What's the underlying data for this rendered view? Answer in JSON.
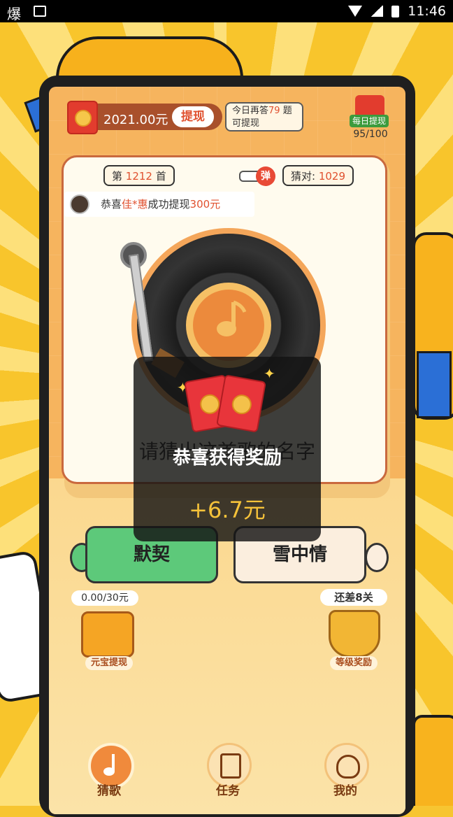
{
  "status_bar": {
    "left_glyph": "爆",
    "time": "11:46"
  },
  "header": {
    "balance": "2021.00元",
    "withdraw_label": "提现",
    "tip_line1_prefix": "今日再答",
    "tip_count": "79",
    "tip_line1_suffix": "题",
    "tip_line2": "可提现",
    "daily_label": "每日提现",
    "daily_progress": "95/100"
  },
  "card": {
    "song_prefix": "第",
    "song_number": "1212",
    "song_suffix": "首",
    "toggle_label": "弹",
    "correct_prefix": "猜对:",
    "correct_count": "1029",
    "notice_prefix": "恭喜",
    "notice_name": "佳*惠",
    "notice_mid": "成功提现",
    "notice_amount": "300元",
    "question": "请猜出这首歌的名字"
  },
  "answers": {
    "a": "默契",
    "b": "雪中情"
  },
  "bonus": {
    "progress": "0.00/30元",
    "chest_label": "元宝提现",
    "gap": "还差8关",
    "trophy_label": "等级奖励"
  },
  "nav": [
    {
      "label": "猜歌"
    },
    {
      "label": "任务"
    },
    {
      "label": "我的"
    }
  ],
  "toast": {
    "title": "恭喜获得奖励",
    "amount": "+6.7元"
  },
  "colors": {
    "accent": "#e0512f",
    "green": "#5dc97a",
    "gold": "#f5c23a"
  }
}
